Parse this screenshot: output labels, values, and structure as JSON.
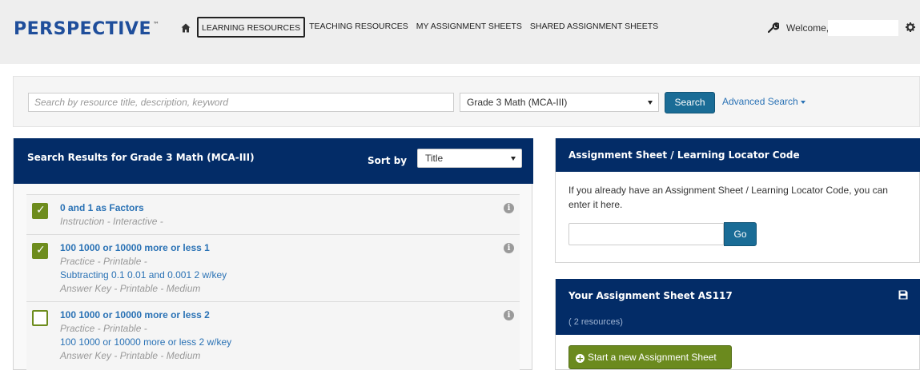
{
  "header": {
    "logo": "PERSPECTIVE",
    "logo_tm": "™",
    "nav": [
      {
        "label": "LEARNING RESOURCES",
        "active": true
      },
      {
        "label": "TEACHING RESOURCES",
        "active": false
      },
      {
        "label": "MY ASSIGNMENT SHEETS",
        "active": false
      },
      {
        "label": "SHARED ASSIGNMENT SHEETS",
        "active": false
      }
    ],
    "welcome": "Welcome,",
    "icons": {
      "home": "home-icon",
      "wrench": "wrench-icon",
      "settings": "gear-icon"
    }
  },
  "search": {
    "placeholder": "Search by resource title, description, keyword",
    "value": "",
    "grade_selected": "Grade 3 Math (MCA-III)",
    "button": "Search",
    "advanced": "Advanced Search"
  },
  "results": {
    "title": "Search Results for Grade 3 Math (MCA-III)",
    "sort_label": "Sort by",
    "sort_selected": "Title",
    "items": [
      {
        "title": "0 and 1 as Factors",
        "checked": true,
        "meta": "Instruction  -  Interactive  -",
        "link": "",
        "link_meta": ""
      },
      {
        "title": "100 1000 or 10000 more or less 1",
        "checked": true,
        "meta": "Practice  -  Printable  -",
        "link": "Subtracting 0.1 0.01 and 0.001 2 w/key",
        "link_meta": "Answer Key  -  Printable  -  Medium"
      },
      {
        "title": "100 1000 or 10000 more or less 2",
        "checked": false,
        "meta": "Practice  -  Printable  -",
        "link": "100 1000 or 10000 more or less 2 w/key",
        "link_meta": "Answer Key  -  Printable  -  Medium"
      }
    ]
  },
  "locator": {
    "title": "Assignment Sheet / Learning Locator Code",
    "text": "If you already have an Assignment Sheet / Learning Locator Code, you can enter it here.",
    "code_value": "",
    "go": "Go"
  },
  "assignment": {
    "title": "Your Assignment Sheet AS117",
    "count": "( 2 resources)",
    "start_button": "Start a new Assignment Sheet"
  },
  "colors": {
    "navy": "#032c67",
    "button_blue": "#1a6c96",
    "green": "#6b8a1e",
    "link": "#2a72b5"
  }
}
